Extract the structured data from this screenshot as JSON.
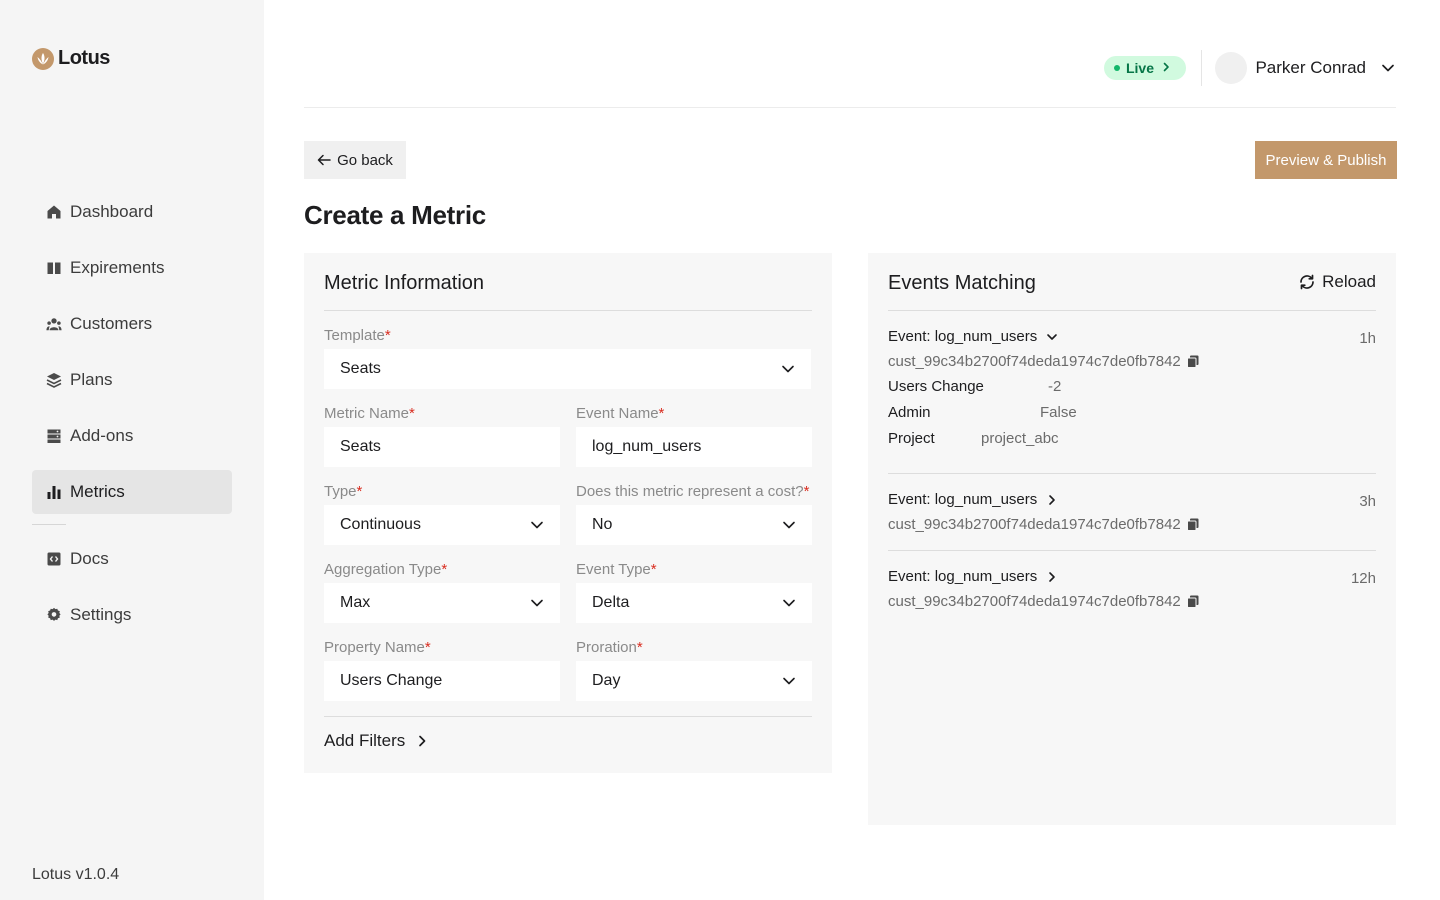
{
  "app": {
    "name": "Lotus",
    "version": "Lotus v1.0.4"
  },
  "sidebar": {
    "items": [
      {
        "label": "Dashboard",
        "icon": "home-icon"
      },
      {
        "label": "Expirements",
        "icon": "book-icon"
      },
      {
        "label": "Customers",
        "icon": "users-icon"
      },
      {
        "label": "Plans",
        "icon": "layers-icon"
      },
      {
        "label": "Add-ons",
        "icon": "database-icon"
      },
      {
        "label": "Metrics",
        "icon": "bar-chart-icon",
        "active": true
      },
      {
        "label": "Docs",
        "icon": "code-doc-icon"
      },
      {
        "label": "Settings",
        "icon": "gear-icon"
      }
    ]
  },
  "header": {
    "env_label": "Live",
    "user_name": "Parker Conrad"
  },
  "page": {
    "back_label": "Go back",
    "publish_label": "Preview & Publish",
    "title": "Create a Metric"
  },
  "metric_info": {
    "title": "Metric Information",
    "template": {
      "label": "Template",
      "value": "Seats"
    },
    "metric_name": {
      "label": "Metric Name",
      "value": "Seats"
    },
    "event_name": {
      "label": "Event Name",
      "value": "log_num_users"
    },
    "type": {
      "label": "Type",
      "value": "Continuous"
    },
    "cost": {
      "label": "Does this metric represent a cost?",
      "value": "No"
    },
    "aggregation_type": {
      "label": "Aggregation Type",
      "value": "Max"
    },
    "event_type": {
      "label": "Event Type",
      "value": "Delta"
    },
    "property_name": {
      "label": "Property Name",
      "value": "Users Change"
    },
    "proration": {
      "label": "Proration",
      "value": "Day"
    },
    "required_mark": "*",
    "add_filters_label": "Add Filters"
  },
  "events": {
    "title": "Events Matching",
    "reload_label": "Reload",
    "items": [
      {
        "title": "Event: log_num_users",
        "time": "1h",
        "customer": "cust_99c34b2700f74deda1974c7de0fb7842",
        "expanded": true,
        "properties": [
          {
            "key": "Users Change",
            "value": "-2"
          },
          {
            "key": "Admin",
            "value": "False"
          },
          {
            "key": "Project",
            "value": "project_abc"
          }
        ]
      },
      {
        "title": "Event: log_num_users",
        "time": "3h",
        "customer": "cust_99c34b2700f74deda1974c7de0fb7842",
        "expanded": false
      },
      {
        "title": "Event: log_num_users",
        "time": "12h",
        "customer": "cust_99c34b2700f74deda1974c7de0fb7842",
        "expanded": false
      }
    ]
  },
  "colors": {
    "accent": "#c3986b",
    "live_bg": "#d1fadf",
    "live_text": "#067647",
    "required": "#d92d20"
  }
}
